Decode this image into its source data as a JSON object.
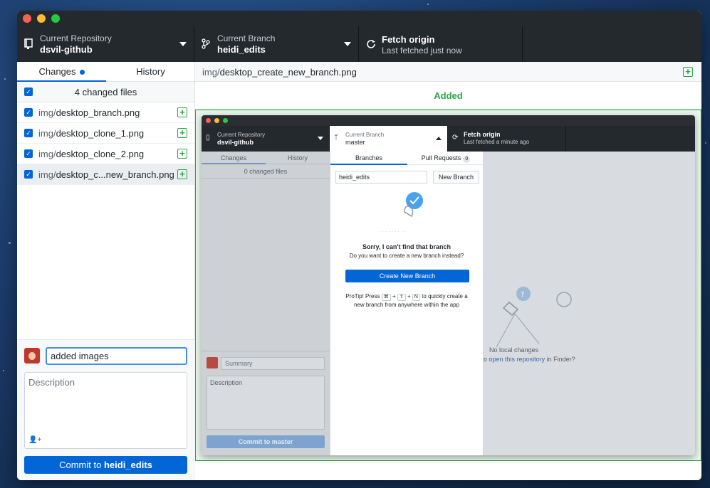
{
  "toolbar": {
    "repo_label": "Current Repository",
    "repo_value": "dsvil-github",
    "branch_label": "Current Branch",
    "branch_value": "heidi_edits",
    "fetch_label": "Fetch origin",
    "fetch_sub": "Last fetched just now"
  },
  "sidebar": {
    "tabs": [
      {
        "label": "Changes"
      },
      {
        "label": "History"
      }
    ],
    "changed_count": "4 changed files",
    "files": [
      {
        "dir": "img/",
        "name": "desktop_branch.png"
      },
      {
        "dir": "img/",
        "name": "desktop_clone_1.png"
      },
      {
        "dir": "img/",
        "name": "desktop_clone_2.png"
      },
      {
        "dir": "img/",
        "name": "desktop_c...new_branch.png"
      }
    ],
    "summary_value": "added images",
    "description_placeholder": "Description",
    "commit_prefix": "Commit to",
    "commit_branch": "heidi_edits"
  },
  "main": {
    "path_dir": "img/",
    "path_file": "desktop_create_new_branch.png",
    "status": "Added"
  },
  "inner": {
    "repo_label": "Current Repository",
    "repo_value": "dsvil-github",
    "branch_label": "Current Branch",
    "branch_value": "master",
    "fetch_label": "Fetch origin",
    "fetch_sub": "Last fetched a minute ago",
    "tabs": [
      {
        "label": "Changes"
      },
      {
        "label": "History"
      }
    ],
    "changed": "0 changed files",
    "summary_placeholder": "Summary",
    "description_placeholder": "Description",
    "commit_label": "Commit to master",
    "no_changes": "No local changes",
    "open_prefix": "o",
    "open_link": "open this repository",
    "open_suffix": "in Finder?",
    "popover": {
      "tabs": [
        {
          "label": "Branches"
        },
        {
          "label": "Pull Requests",
          "count": "0"
        }
      ],
      "filter_value": "heidi_edits",
      "new_branch": "New Branch",
      "sorry": "Sorry, I can't find that branch",
      "question": "Do you want to create a new branch instead?",
      "create": "Create New Branch",
      "tip_a": "ProTip! Press",
      "tip_k1": "⌘",
      "tip_k2": "⇧",
      "tip_k3": "N",
      "tip_b": "to quickly create a new branch from anywhere within the app"
    }
  },
  "colors": {
    "accent": "#0366d6",
    "added": "#28a745",
    "toolbar": "#24292e"
  }
}
